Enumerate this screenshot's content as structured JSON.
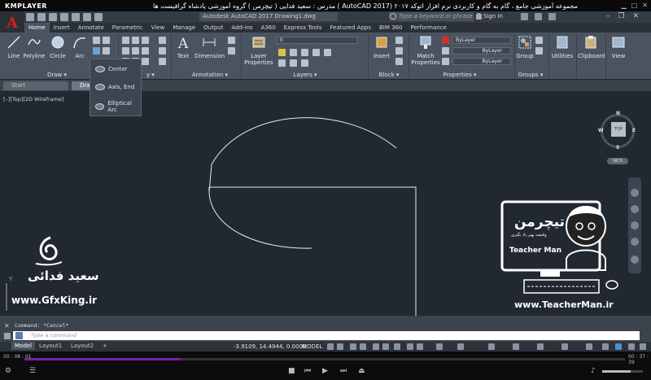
{
  "player": {
    "logo": "KMPLAYER",
    "title": "مجموعه آموزشی جامع ، گام به گام و کاربردی نرم افزار    اتوکد  ۲۰۱۷ (AutoCAD  2017 )   مدرس : سعید فدایی ( تیچرمن ) گروه آموزشی پادشاه گرافیست ها",
    "time_elapsed": "00 : 08 : 01",
    "time_total": "00 : 37 : 39",
    "progress": 0.26,
    "volume": 0.7
  },
  "acad": {
    "window_title": "Autodesk AutoCAD 2017    Drawing1.dwg",
    "search_placeholder": "Type a keyword or phrase",
    "sign_in": "Sign In",
    "tabs": [
      {
        "label": "Home",
        "active": true
      },
      {
        "label": "Insert"
      },
      {
        "label": "Annotate"
      },
      {
        "label": "Parametric"
      },
      {
        "label": "View"
      },
      {
        "label": "Manage"
      },
      {
        "label": "Output"
      },
      {
        "label": "Add-ins"
      },
      {
        "label": "A360"
      },
      {
        "label": "Express Tools"
      },
      {
        "label": "Featured Apps"
      },
      {
        "label": "BIM 360"
      },
      {
        "label": "Performance"
      }
    ]
  },
  "ribbon": {
    "draw": {
      "line": "Line",
      "polyline": "Polyline",
      "circle": "Circle",
      "arc": "Arc",
      "panel": "Draw ▾"
    },
    "modify": {
      "panel": "y ▾"
    },
    "annotation": {
      "text": "Text",
      "dimension": "Dimension",
      "panel": "Annotation ▾"
    },
    "layers": {
      "layer_properties": "Layer Properties",
      "layer_value": "0",
      "panel": "Layers ▾"
    },
    "block": {
      "insert": "Insert",
      "panel": "Block ▾"
    },
    "properties": {
      "match": "Match Properties",
      "bylayer1": "ByLayer",
      "bylayer2": "ByLayer",
      "bylayer3": "ByLayer",
      "panel": "Properties ▾"
    },
    "groups": {
      "group": "Group",
      "panel": "Groups ▾"
    },
    "utilities": "Utilities",
    "clipboard": "Clipboard",
    "view": "View"
  },
  "ellipse_menu": {
    "items": [
      "Center",
      "Axis, End",
      "Elliptical Arc"
    ]
  },
  "file_tabs": {
    "start": "Start",
    "drawing": "Draw"
  },
  "viewport": {
    "label": "[–][Top][2D Wireframe]",
    "viewcube_top": "TOP",
    "north": "N",
    "south": "S",
    "east": "E",
    "west": "W",
    "wcs": "WCS"
  },
  "watermark": {
    "left_name": "سعید فدائی",
    "left_url": "www.GfxKing.ir",
    "right_url": "www.TeacherMan.ir",
    "logo_persian": "تیچرمن",
    "logo_sub": "وقتشه بهتر یاد بگیری",
    "logo_en": "Teacher Man"
  },
  "command": {
    "history": "Command: *Cancel*",
    "placeholder": "Type a command"
  },
  "status": {
    "layout_tabs": [
      {
        "label": "Model",
        "active": true
      },
      {
        "label": "Layout1"
      },
      {
        "label": "Layout2"
      },
      {
        "label": "+"
      }
    ],
    "coords": "-3.9109, 14.4944, 0.0000",
    "model": "MODEL"
  },
  "colors": {
    "canvas": "#212830",
    "ribbon": "#4a5460",
    "seek": "#7a1fa8",
    "acad_red": "#d42020"
  }
}
